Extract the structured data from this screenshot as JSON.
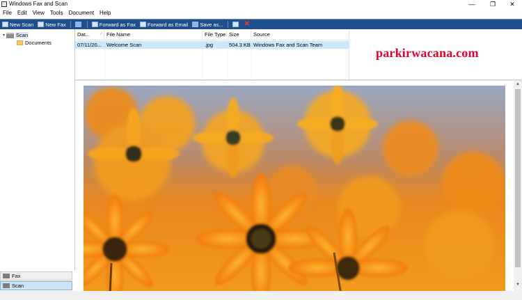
{
  "window": {
    "title": "Windows Fax and Scan"
  },
  "menu": [
    "File",
    "Edit",
    "View",
    "Tools",
    "Document",
    "Help"
  ],
  "toolbar": {
    "new_scan": "New Scan",
    "new_fax": "New Fax",
    "forward_fax": "Forward as Fax",
    "forward_email": "Forward as Email",
    "save_as": "Save as..."
  },
  "tree": {
    "root": "Scan",
    "child": "Documents"
  },
  "list": {
    "columns": [
      "Dat...",
      "File Name",
      "File Type",
      "Size",
      "Source"
    ],
    "rows": [
      {
        "date": "07/11/20...",
        "name": "Welcome Scan",
        "type": ".jpg",
        "size": "504.3 KB",
        "source": "Windows Fax and Scan Team"
      }
    ]
  },
  "watermark": "parkirwacana.com",
  "nav": {
    "fax": "Fax",
    "scan": "Scan"
  },
  "icons": [
    "app-icon",
    "scanner-icon",
    "fax-icon",
    "envelope-icon",
    "save-icon",
    "print-icon",
    "delete-icon",
    "folder-icon"
  ],
  "colors": {
    "toolbar_bg": "#1e4e8c",
    "selected_row": "#cce8ff",
    "watermark": "#e3002b"
  }
}
